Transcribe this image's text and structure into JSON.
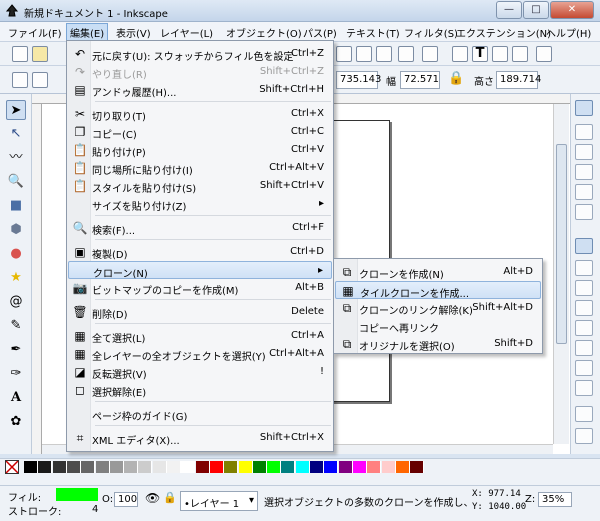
{
  "window": {
    "title": "新規ドキュメント 1 - Inkscape",
    "minimize": "—",
    "maximize": "□",
    "close": "✕"
  },
  "menubar": [
    "ファイル(F)",
    "編集(E)",
    "表示(V)",
    "レイヤー(L)",
    "オブジェクト(O)",
    "パス(P)",
    "テキスト(T)",
    "フィルタ(S)",
    "エクステンション(N)",
    "ヘルプ(H)"
  ],
  "toolbar2": {
    "x_value": "735.143",
    "w_label": "幅",
    "w_value": "72.571",
    "h_label": "高さ",
    "h_value": "189.714"
  },
  "edit_menu": [
    {
      "label": "元に戻す(U): スウォッチからフィル色を設定",
      "accel": "Ctrl+Z",
      "icon": "undo-icon",
      "glyph": "↶",
      "disabled": false
    },
    {
      "label": "やり直し(R)",
      "accel": "Shift+Ctrl+Z",
      "icon": "redo-icon",
      "glyph": "↷",
      "disabled": true
    },
    {
      "label": "アンドゥ履歴(H)...",
      "accel": "Shift+Ctrl+H",
      "icon": "history-icon",
      "glyph": "▤",
      "disabled": false
    },
    {
      "label": "切り取り(T)",
      "accel": "Ctrl+X",
      "icon": "cut-icon",
      "glyph": "✂",
      "disabled": false
    },
    {
      "label": "コピー(C)",
      "accel": "Ctrl+C",
      "icon": "copy-icon",
      "glyph": "❐",
      "disabled": false
    },
    {
      "label": "貼り付け(P)",
      "accel": "Ctrl+V",
      "icon": "paste-icon",
      "glyph": "📋",
      "disabled": false
    },
    {
      "label": "同じ場所に貼り付け(I)",
      "accel": "Ctrl+Alt+V",
      "icon": "paste-in-place-icon",
      "glyph": "📋",
      "disabled": false
    },
    {
      "label": "スタイルを貼り付け(S)",
      "accel": "Shift+Ctrl+V",
      "icon": "paste-style-icon",
      "glyph": "📋",
      "disabled": false
    },
    {
      "label": "サイズを貼り付け(Z)",
      "accel": "▸",
      "icon": "",
      "glyph": "",
      "disabled": false
    },
    {
      "label": "検索(F)...",
      "accel": "Ctrl+F",
      "icon": "find-icon",
      "glyph": "🔍",
      "disabled": false
    },
    {
      "label": "複製(D)",
      "accel": "Ctrl+D",
      "icon": "duplicate-icon",
      "glyph": "▣",
      "disabled": false
    },
    {
      "label": "クローン(N)",
      "accel": "▸",
      "icon": "",
      "glyph": "",
      "disabled": false
    },
    {
      "label": "ビットマップのコピーを作成(M)",
      "accel": "Alt+B",
      "icon": "bitmap-icon",
      "glyph": "📷",
      "disabled": false
    },
    {
      "label": "削除(D)",
      "accel": "Delete",
      "icon": "delete-icon",
      "glyph": "🗑",
      "disabled": false
    },
    {
      "label": "全て選択(L)",
      "accel": "Ctrl+A",
      "icon": "select-all-icon",
      "glyph": "▦",
      "disabled": false
    },
    {
      "label": "全レイヤーの全オブジェクトを選択(Y)",
      "accel": "Ctrl+Alt+A",
      "icon": "select-all-layers-icon",
      "glyph": "▦",
      "disabled": false
    },
    {
      "label": "反転選択(V)",
      "accel": "!",
      "icon": "invert-icon",
      "glyph": "◪",
      "disabled": false
    },
    {
      "label": "選択解除(E)",
      "accel": "",
      "icon": "deselect-icon",
      "glyph": "◻",
      "disabled": false
    },
    {
      "label": "ページ枠のガイド(G)",
      "accel": "",
      "icon": "",
      "glyph": "",
      "disabled": false
    },
    {
      "label": "XML エディタ(X)...",
      "accel": "Shift+Ctrl+X",
      "icon": "xml-editor-icon",
      "glyph": "⌗",
      "disabled": false
    }
  ],
  "clone_submenu": [
    {
      "label": "クローンを作成(N)",
      "accel": "Alt+D",
      "icon": "clone-icon",
      "glyph": "⧉"
    },
    {
      "label": "タイルクローンを作成...",
      "accel": "",
      "icon": "tile-clone-icon",
      "glyph": "▦"
    },
    {
      "label": "クローンのリンク解除(K)",
      "accel": "Shift+Alt+D",
      "icon": "unlink-clone-icon",
      "glyph": "⧉"
    },
    {
      "label": "コピーへ再リンク",
      "accel": "",
      "icon": "",
      "glyph": ""
    },
    {
      "label": "オリジナルを選択(O)",
      "accel": "Shift+D",
      "icon": "select-original-icon",
      "glyph": "⧉"
    }
  ],
  "status": {
    "fill_label": "フィル:",
    "stroke_label": "ストローク:",
    "stroke_width": "4",
    "opacity_label": "O:",
    "opacity_value": "100",
    "layer": "•レイヤー 1",
    "message": "選択オブジェクトの多数のクローンを作成し、",
    "x_coord": "X:  977.14",
    "y_coord": "Y: 1040.00",
    "zoom_label": "Z:",
    "zoom_value": "35%"
  },
  "colors": {
    "fill": "#00ff00",
    "accent": "#8fb3dc"
  }
}
